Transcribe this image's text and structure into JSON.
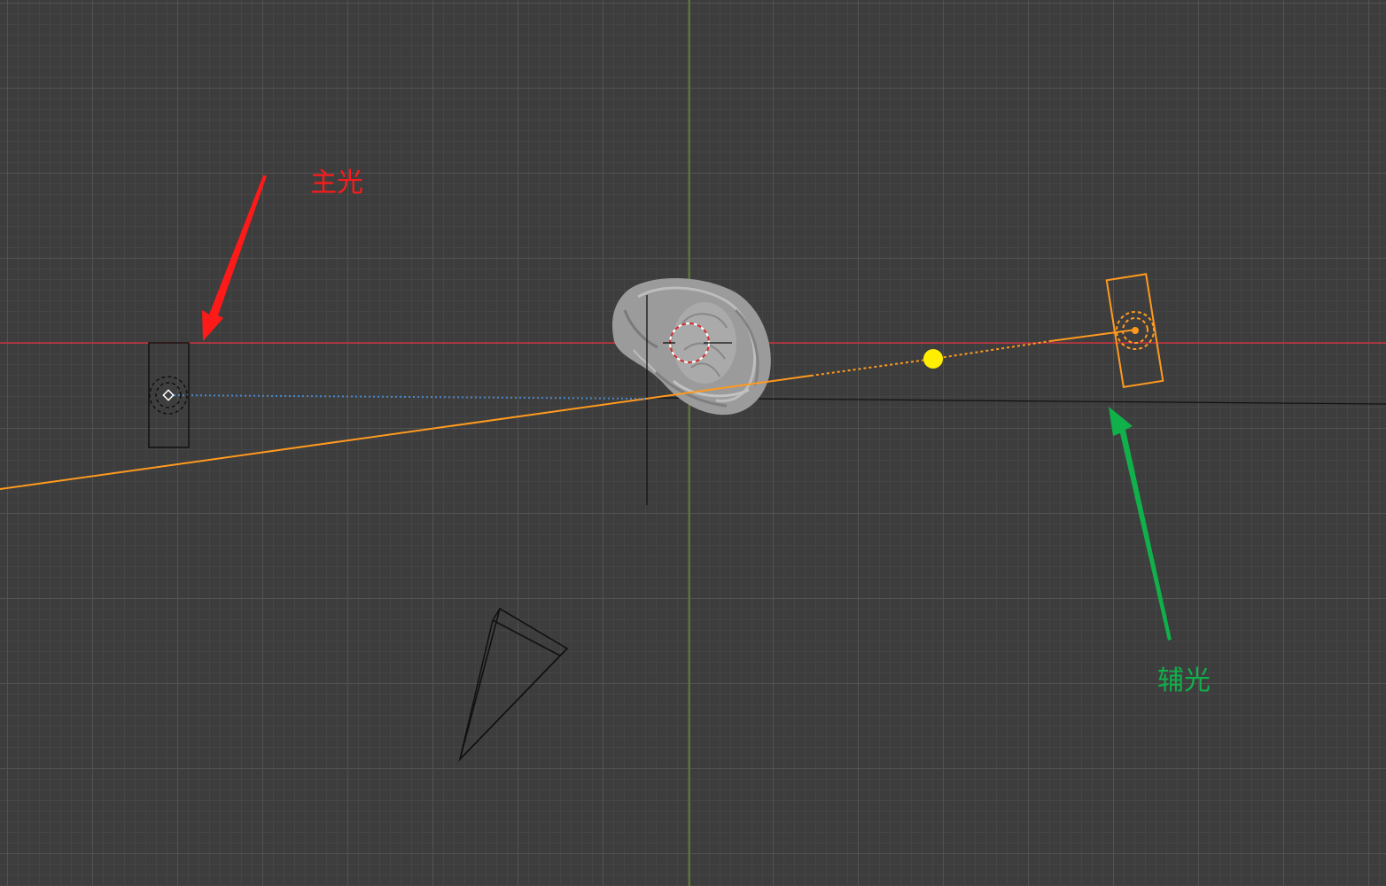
{
  "viewport": {
    "background": "#3d3d3d",
    "grid_minor_color": "#454545",
    "grid_major_color": "#525252",
    "axis_x_color": "#c8323c",
    "axis_y_color": "#5e8c22"
  },
  "annotations": {
    "key_light": {
      "label": "主光",
      "color": "#ff1a1a",
      "arrow_icon": "red-arrow-icon"
    },
    "fill_light": {
      "label": "辅光",
      "color": "#10b04a",
      "arrow_icon": "green-arrow-icon"
    }
  },
  "objects": {
    "key_light": {
      "icon": "area-light-icon",
      "selected": false,
      "color": "#111111"
    },
    "fill_light": {
      "icon": "area-light-icon",
      "selected": true,
      "color": "#ff9a1f"
    },
    "camera": {
      "icon": "camera-icon",
      "color": "#111111"
    },
    "sculpture": {
      "icon": "sculpted-head-icon",
      "color": "#a9a9a9"
    },
    "target_handle": {
      "icon": "light-target-handle-icon",
      "color": "#ffee00"
    },
    "cursor_3d": {
      "icon": "3d-cursor-icon"
    }
  }
}
